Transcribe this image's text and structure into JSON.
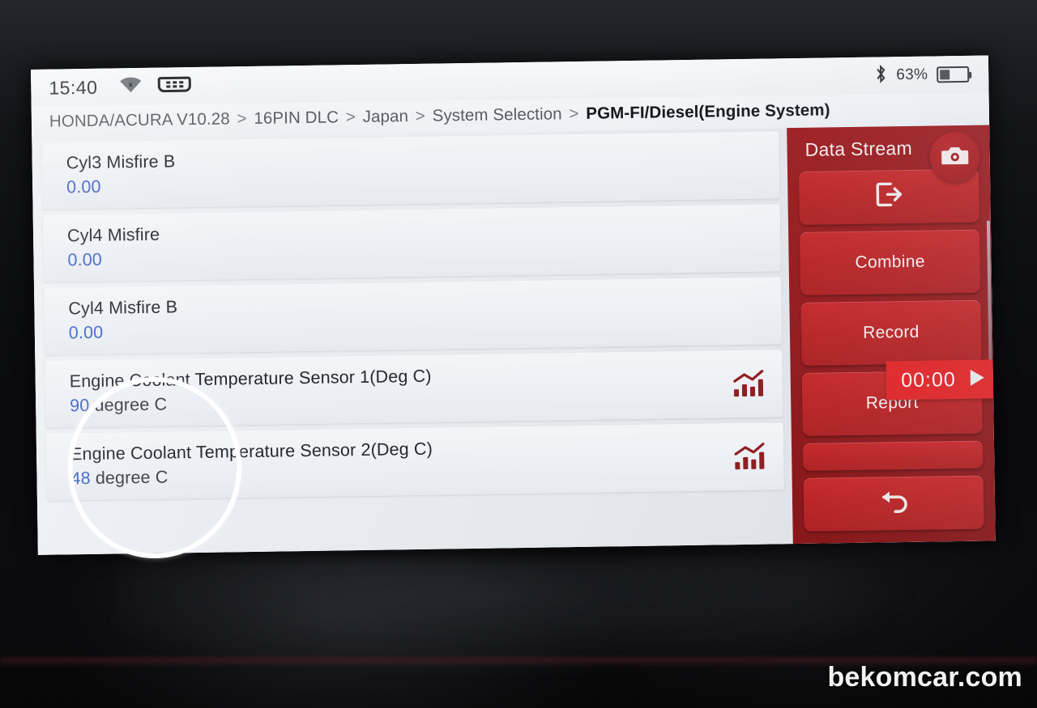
{
  "status_bar": {
    "clock": "15:40",
    "wifi_icon": "wifi-off-icon",
    "vci_icon": "vci-connector-icon",
    "bluetooth_icon": "bluetooth-icon",
    "battery_percent": "63%",
    "battery_level": 63
  },
  "breadcrumb": {
    "items": [
      "HONDA/ACURA V10.28",
      "16PIN DLC",
      "Japan",
      "System Selection"
    ],
    "separator": ">",
    "current": "PGM-FI/Diesel(Engine System)"
  },
  "data_stream": {
    "rows": [
      {
        "name": "Cyl3 Misfire B",
        "value": "0.00",
        "unit": "",
        "has_graph": false
      },
      {
        "name": "Cyl4 Misfire",
        "value": "0.00",
        "unit": "",
        "has_graph": false
      },
      {
        "name": "Cyl4 Misfire B",
        "value": "0.00",
        "unit": "",
        "has_graph": false
      },
      {
        "name": "Engine Coolant Temperature Sensor 1(Deg C)",
        "value": "90",
        "unit": "degree C",
        "has_graph": true
      },
      {
        "name": "Engine Coolant Temperature Sensor 2(Deg C)",
        "value": "48",
        "unit": "degree C",
        "has_graph": true
      }
    ]
  },
  "tool_panel": {
    "title": "Data Stream",
    "camera_icon": "camera-icon",
    "exit_icon": "exit-icon",
    "buttons": [
      {
        "label": "",
        "icon": "exit-icon"
      },
      {
        "label": "Combine",
        "icon": ""
      },
      {
        "label": "Record",
        "icon": ""
      },
      {
        "label": "Report",
        "icon": ""
      },
      {
        "label": "",
        "icon": ""
      },
      {
        "label": "",
        "icon": "back-arrow-icon"
      }
    ],
    "timer": "00:00",
    "play_icon": "play-icon"
  },
  "annotation": {
    "shape": "ellipse",
    "color": "#ffffff"
  },
  "watermark": {
    "text": "bekomcar.com"
  },
  "colors": {
    "panel_red": "#951b1e",
    "button_red": "#bb2527",
    "timer_red": "#e02528",
    "value_blue": "#3f63c7",
    "graph_icon_red": "#8f1f22"
  }
}
